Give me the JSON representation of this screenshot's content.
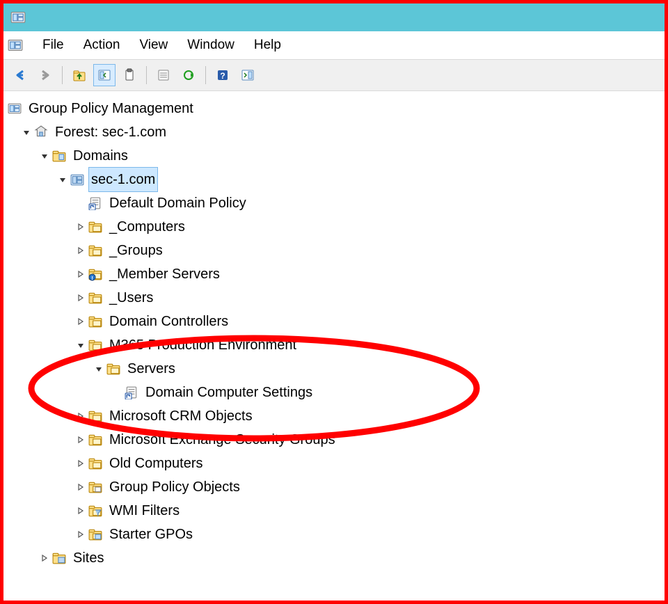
{
  "menu": {
    "file": "File",
    "action": "Action",
    "view": "View",
    "window": "Window",
    "help": "Help"
  },
  "tree": {
    "root": "Group Policy Management",
    "forest": "Forest: sec-1.com",
    "domains": "Domains",
    "domain": "sec-1.com",
    "ddp": "Default Domain Policy",
    "computers": "_Computers",
    "groups": "_Groups",
    "memberservers": "_Member Servers",
    "users": "_Users",
    "dc": "Domain Controllers",
    "m365": "M365 Production Environment",
    "servers": "Servers",
    "dcs": "Domain Computer Settings",
    "crm": "Microsoft CRM Objects",
    "exch": "Microsoft Exchange Security Groups",
    "oldcomp": "Old Computers",
    "gpo": "Group Policy Objects",
    "wmi": "WMI Filters",
    "starter": "Starter GPOs",
    "sites": "Sites"
  }
}
